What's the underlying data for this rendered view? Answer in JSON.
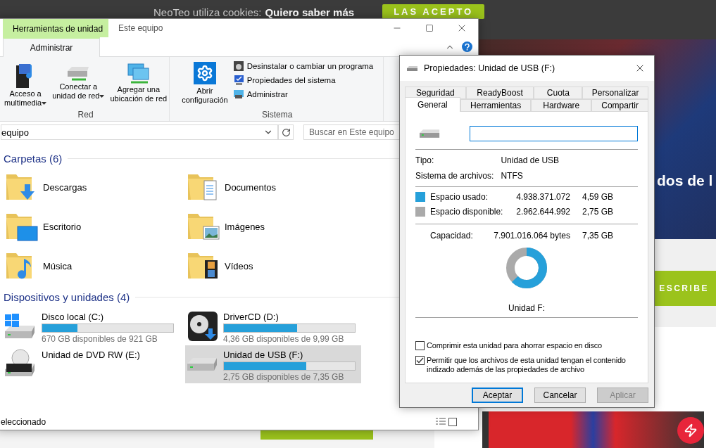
{
  "web_page": {
    "cookie_notice": "NeoTeo utiliza cookies:",
    "cookie_link": "Quiero saber más",
    "accept_button": "LAS ACEPTO",
    "headline_fragment": "dos de l",
    "subscribe_button": "ESCRIBE"
  },
  "explorer": {
    "contextual_header": "Herramientas de unidad",
    "title": "Este equipo",
    "tabs": [
      {
        "label": "Administrar",
        "selected": true
      }
    ],
    "ribbon_groups": [
      {
        "label": "Red",
        "items": [
          {
            "lines": [
              "Acceso a",
              "multimedia"
            ],
            "dropdown": true
          },
          {
            "lines": [
              "Conectar a",
              "unidad de red"
            ],
            "dropdown": true
          },
          {
            "lines": [
              "Agregar una",
              "ubicación de red"
            ],
            "dropdown": false
          }
        ]
      },
      {
        "label": "Sistema",
        "items": [
          {
            "lines": [
              "Abrir",
              "configuración"
            ],
            "dropdown": false
          }
        ],
        "small_items": [
          "Desinstalar o cambiar un programa",
          "Propiedades del sistema",
          "Administrar"
        ]
      }
    ],
    "address": "equipo",
    "search": {
      "placeholder": "Buscar en Este equipo"
    },
    "folders": {
      "heading": "Carpetas (6)",
      "items": [
        {
          "name": "Descargas",
          "kind": "downloads"
        },
        {
          "name": "Documentos",
          "kind": "documents"
        },
        {
          "name": "Escritorio",
          "kind": "desktop"
        },
        {
          "name": "Imágenes",
          "kind": "pictures"
        },
        {
          "name": "Música",
          "kind": "music"
        },
        {
          "name": "Vídeos",
          "kind": "videos"
        }
      ]
    },
    "drives": {
      "heading": "Dispositivos y unidades (4)",
      "items": [
        {
          "name": "Disco local (C:)",
          "kind": "system-disk",
          "level": 0.27,
          "free": "670 GB disponibles de 921 GB",
          "selected": false
        },
        {
          "name": "DriverCD (D:)",
          "kind": "cd",
          "level": 0.56,
          "free": "4,36 GB disponibles de 9,99 GB",
          "selected": false
        },
        {
          "name": "Unidad de DVD RW (E:)",
          "kind": "dvd",
          "selected": false
        },
        {
          "name": "Unidad de USB (F:)",
          "kind": "usb",
          "level": 0.63,
          "free": "2,75 GB disponibles de 7,35 GB",
          "selected": true
        }
      ]
    },
    "status": "eleccionado"
  },
  "dialog": {
    "title": "Propiedades: Unidad de USB (F:)",
    "tab_rows": [
      [
        {
          "label": "Seguridad",
          "selected": false
        },
        {
          "label": "ReadyBoost",
          "selected": false
        },
        {
          "label": "Cuota",
          "selected": false
        },
        {
          "label": "Personalizar",
          "selected": false
        }
      ],
      [
        {
          "label": "General",
          "selected": true
        },
        {
          "label": "Herramientas",
          "selected": false
        },
        {
          "label": "Hardware",
          "selected": false
        },
        {
          "label": "Compartir",
          "selected": false
        }
      ]
    ],
    "name_field": {
      "focused": true
    },
    "info": [
      {
        "label": "Tipo:",
        "value": "Unidad de USB"
      },
      {
        "label": "Sistema de archivos:",
        "value": "NTFS"
      }
    ],
    "usage": [
      {
        "label": "Espacio usado:",
        "bytes": "4.938.371.072",
        "size": "4,59 GB",
        "color": "#26a0da"
      },
      {
        "label": "Espacio disponible:",
        "bytes": "2.962.644.992",
        "size": "2,75 GB",
        "color": "#aaaaaa"
      }
    ],
    "capacity": {
      "label": "Capacidad:",
      "bytes": "7.901.016.064 bytes",
      "size": "7,35 GB"
    },
    "donut": {
      "level": 0.625
    },
    "drive_label": "Unidad F:",
    "options": [
      {
        "label": "Comprimir esta unidad para ahorrar espacio en disco",
        "checked": false
      },
      {
        "label": "Permitir que los archivos de esta unidad tengan el contenido indizado además de las propiedades de archivo",
        "checked": true
      }
    ],
    "buttons": [
      {
        "label": "Aceptar",
        "default": true,
        "disabled": false
      },
      {
        "label": "Cancelar",
        "default": false,
        "disabled": false
      },
      {
        "label": "Aplicar",
        "default": false,
        "disabled": true
      }
    ]
  }
}
